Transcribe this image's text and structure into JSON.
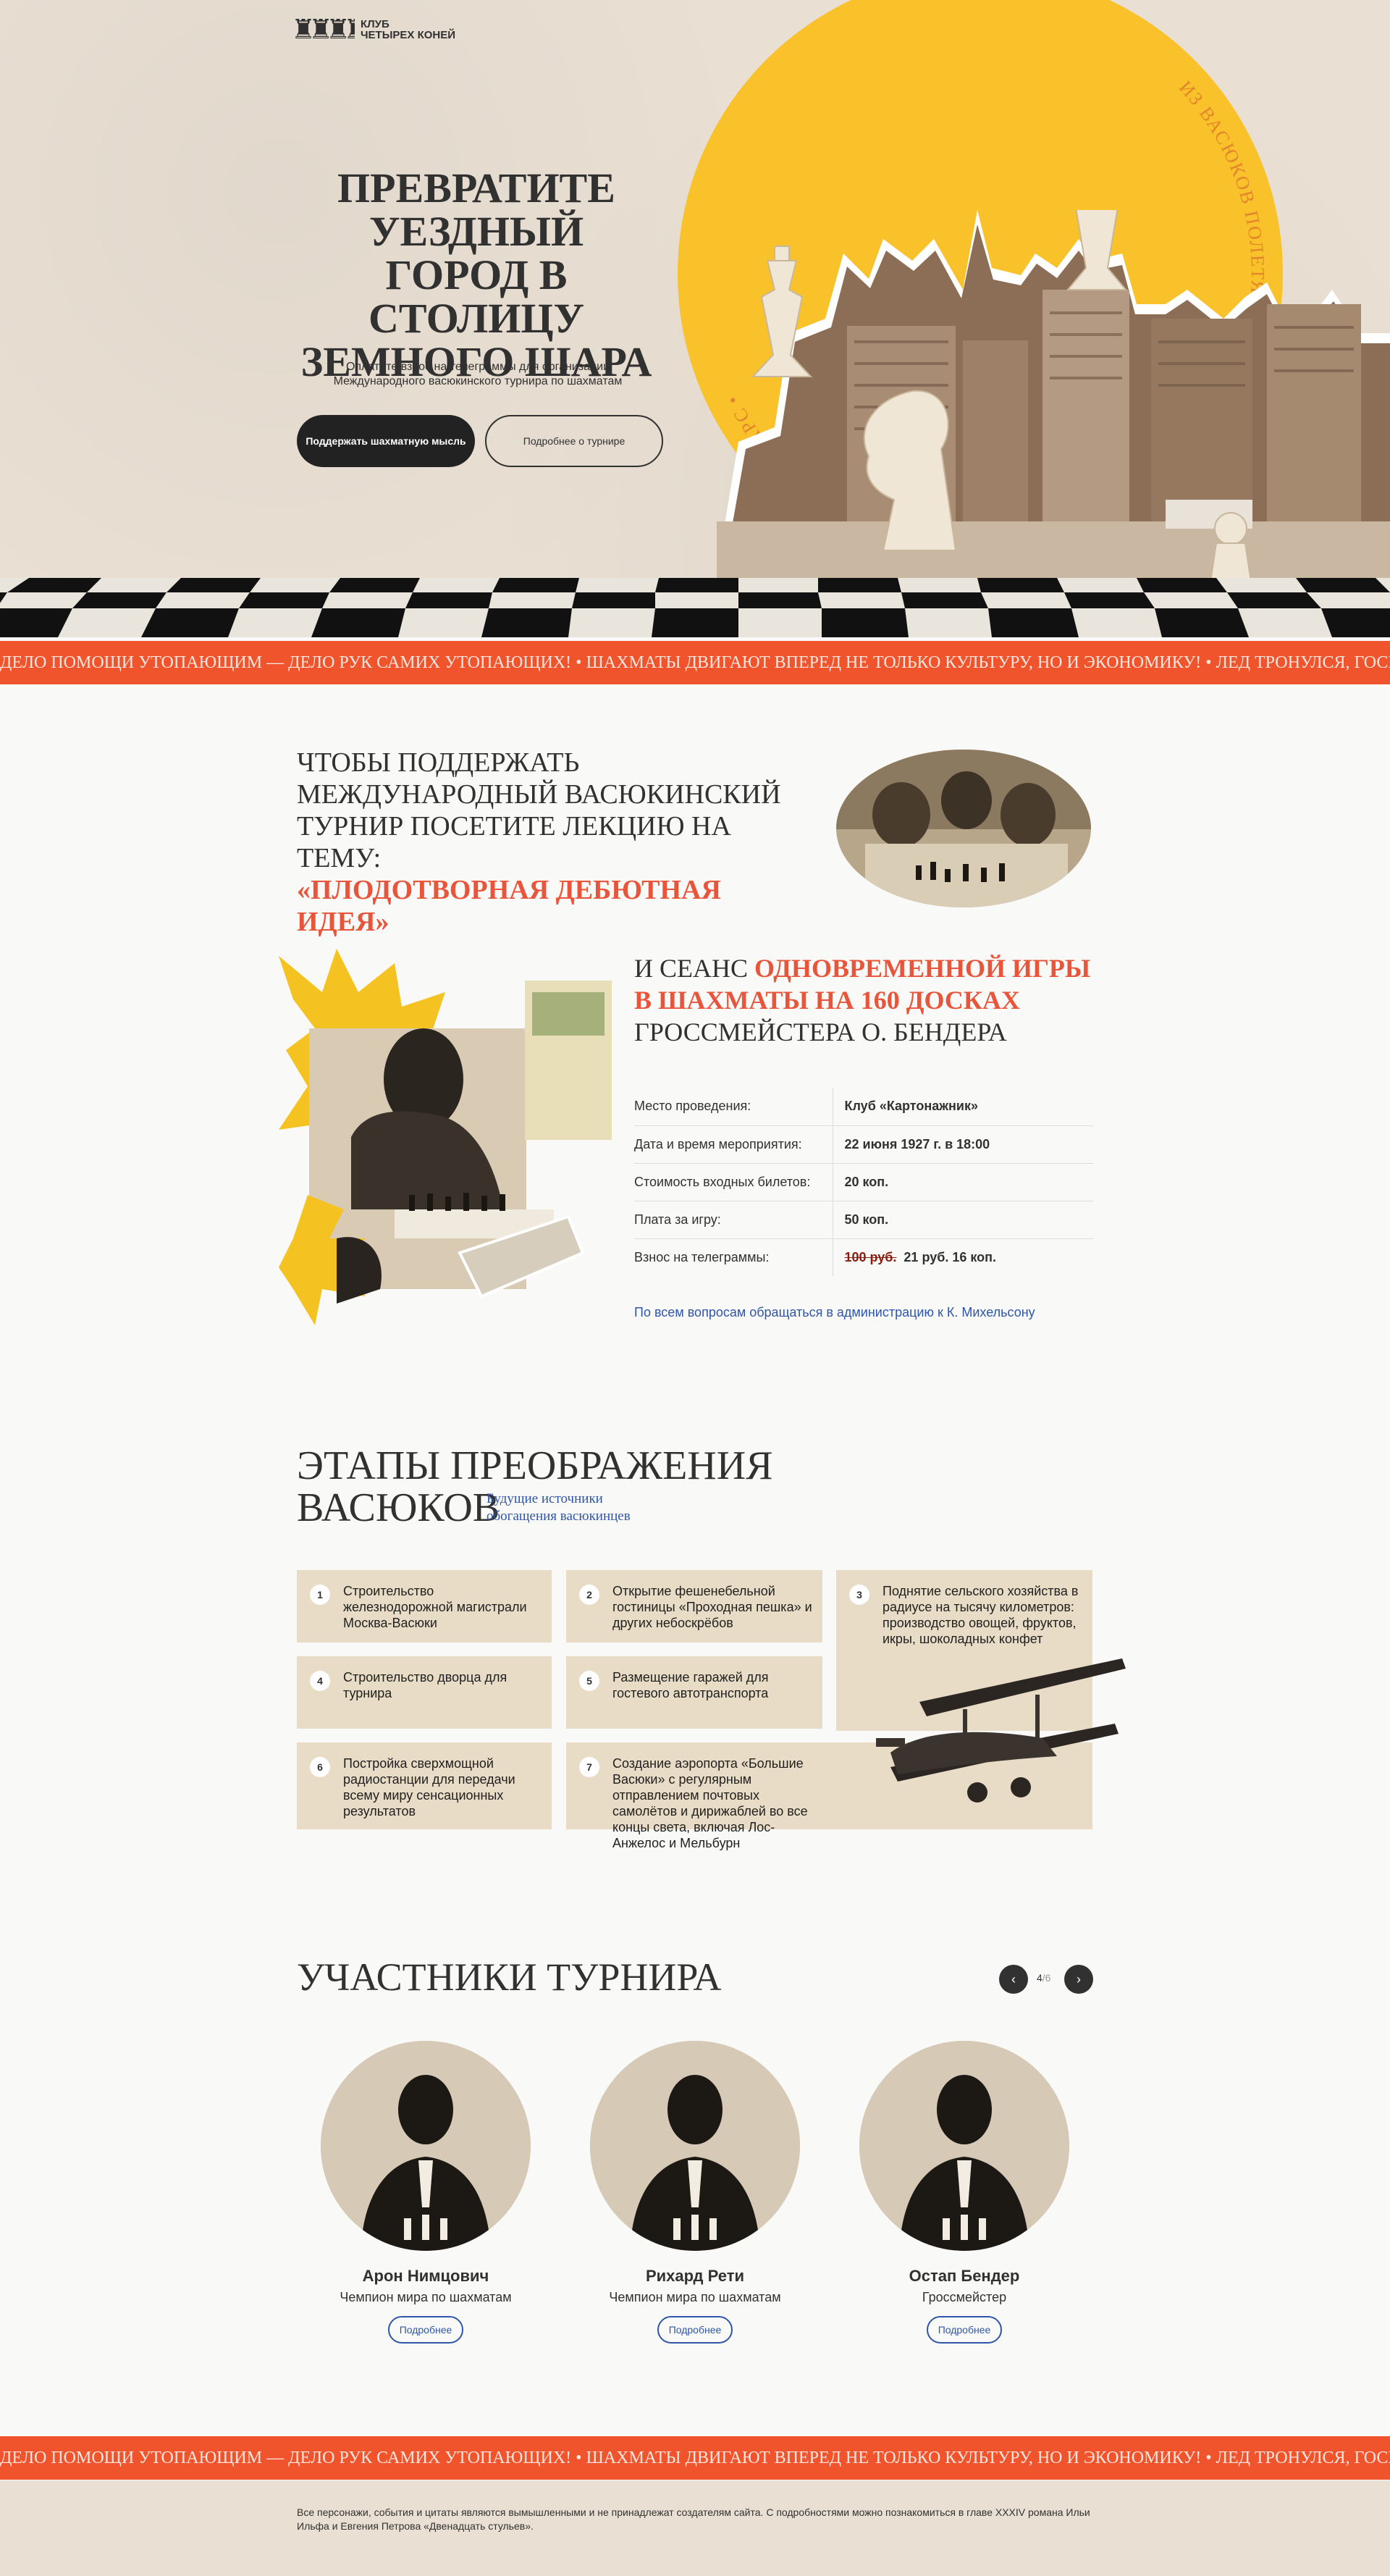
{
  "logo": {
    "icon": "♜♜♜♜",
    "text_line1": "КЛУБ",
    "text_line2": "ЧЕТЫРЕХ КОНЕЙ"
  },
  "hero": {
    "title": "ПРЕВРАТИТЕ УЕЗДНЫЙ ГОРОД В СТОЛИЦУ ЗЕМНОГО ШАРА",
    "subtitle": "Оплатите взнос на телеграммы для организации Международного васюкинского турнира по шахматам",
    "btn_primary": "Поддержать шахматную мысль",
    "btn_secondary": "Подробнее о турнире",
    "sun_text": "ИЗ ВАСЮКОВ ПОЛЕТЯТ СИГНАЛЫ НА МАРС • ИЗ ВАСЮКОВ ПОЛЕТЯТ СИГНАЛЫ НА МАРС • "
  },
  "ticker": {
    "text": "ДЕЛО ПОМОЩИ УТОПАЮЩИМ — ДЕЛО РУК САМИХ УТОПАЮЩИХ!  •  ШАХМАТЫ ДВИГАЮТ ВПЕРЕД НЕ ТОЛЬКО КУЛЬТУРУ, НО И ЭКОНОМИКУ!  •  ЛЕД ТРОНУЛСЯ, ГОСПОДА ПРИСЯЖНЫЕ ЗАСЕДАТЕЛИ!  •  "
  },
  "lecture": {
    "title": "ЧТОБЫ ПОДДЕРЖАТЬ МЕЖДУНАРОДНЫЙ ВАСЮКИНСКИЙ ТУРНИР ПОСЕТИТЕ ЛЕКЦИЮ НА ТЕМУ:",
    "highlight": "«ПЛОДОТВОРНАЯ ДЕБЮТНАЯ ИДЕЯ»"
  },
  "session": {
    "title_pre": "И СЕАНС ",
    "title_hl": "ОДНОВРЕМЕННОЙ ИГРЫ В ШАХМАТЫ НА 160 ДОСКАХ",
    "title_post": " ГРОССМЕЙСТЕРА О. БЕНДЕРА",
    "rows": [
      {
        "k": "Место проведения:",
        "v": "Клуб «Картонажник»"
      },
      {
        "k": "Дата и время мероприятия:",
        "v": "22 июня 1927 г. в 18:00"
      },
      {
        "k": "Стоимость входных билетов:",
        "v": "20 коп."
      },
      {
        "k": "Плата за игру:",
        "v": "50 коп."
      },
      {
        "k": "Взнос на телеграммы:",
        "v": "21 руб. 16 коп.",
        "old": "100 руб."
      }
    ],
    "contact": "По всем вопросам обращаться в администрацию к К. Михельсону"
  },
  "stages": {
    "title_line1": "ЭТАПЫ ПРЕОБРАЖЕНИЯ",
    "title_line2": "ВАСЮКОВ",
    "note": "Будущие источники обогащения васюкинцев",
    "items": [
      {
        "n": "1",
        "t": "Строительство железнодорожной магистрали Москва-Васюки"
      },
      {
        "n": "2",
        "t": "Открытие фешенебельной гостиницы «Проходная пешка» и других небоскрёбов"
      },
      {
        "n": "3",
        "t": "Поднятие сельского хозяйства в радиусе на тысячу километров: производство овощей, фруктов, икры, шоколадных конфет"
      },
      {
        "n": "4",
        "t": "Строительство дворца для турнира"
      },
      {
        "n": "5",
        "t": "Размещение гаражей для гостевого автотранспорта"
      },
      {
        "n": "6",
        "t": "Постройка сверхмощной радиостанции для передачи всему миру сенсационных результатов"
      },
      {
        "n": "7",
        "t": "Создание аэропорта «Большие Васюки» с регулярным отправлением почтовых самолётов и дирижаблей во все концы света, включая Лос-Анжелос и Мельбурн"
      }
    ]
  },
  "participants": {
    "title": "УЧАСТНИКИ ТУРНИРА",
    "prev": "‹",
    "next": "›",
    "page_current": "4",
    "page_total": "/6",
    "more_label": "Подробнее",
    "people": [
      {
        "name": "Арон Нимцович",
        "role": "Чемпион мира по шахматам"
      },
      {
        "name": "Рихард Рети",
        "role": "Чемпион мира по шахматам"
      },
      {
        "name": "Остап Бендер",
        "role": "Гроссмейстер"
      }
    ]
  },
  "footer": {
    "text": "Все персонажи, события и цитаты являются вымышленными и не принадлежат создателям сайта. С подробностями можно познакомиться в главе XXXIV романа Ильи Ильфа и Евгения Петрова «Двенадцать стульев»."
  },
  "colors": {
    "accent": "#f0542d",
    "sun": "#f9c22a",
    "beige": "#e9dfd3",
    "link": "#2f56a8"
  }
}
